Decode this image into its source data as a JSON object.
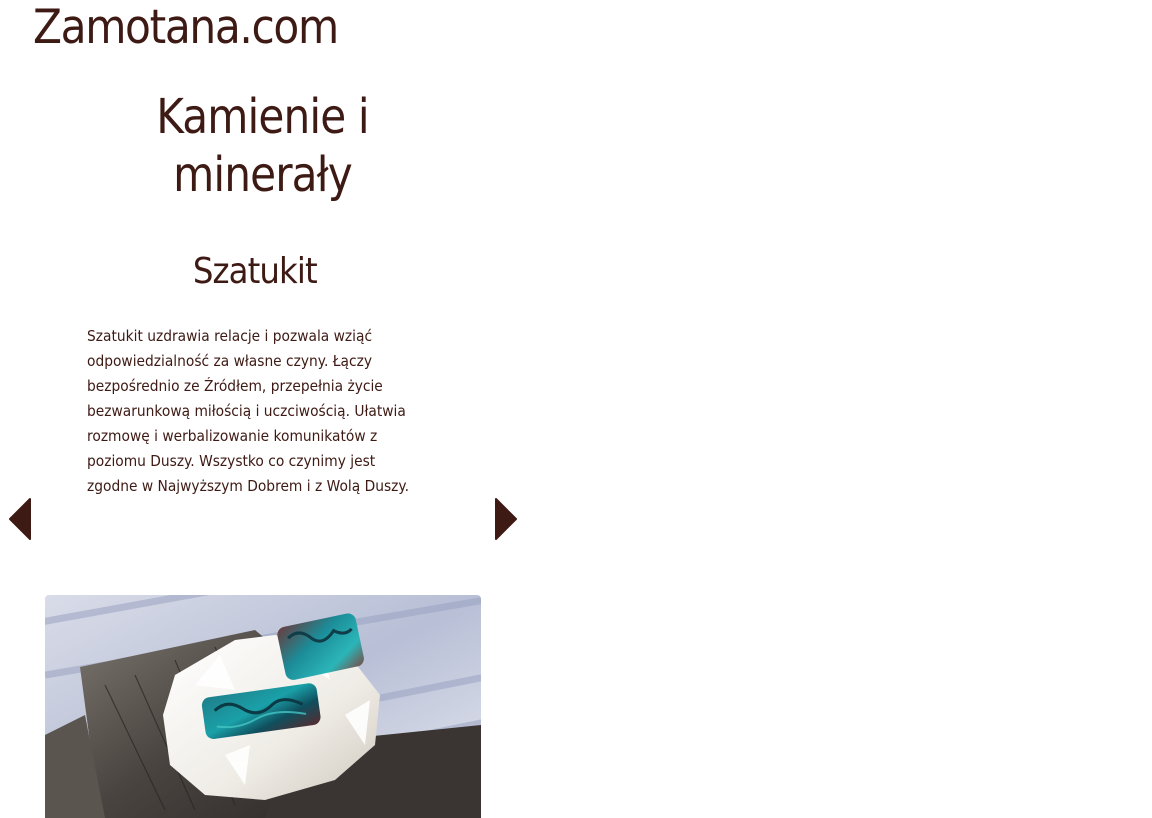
{
  "site": {
    "logo": "Zamotana.com"
  },
  "page": {
    "title_line1": "Kamienie i",
    "title_line2": "minerały"
  },
  "stone": {
    "name": "Szatukit",
    "description": "Szatukit uzdrawia relacje i pozwala wziąć odpowiedzialność za własne czyny. Łączy bezpośrednio ze Źródłem, przepełnia życie bezwarunkową miłością i uczciwością. Ułatwia rozmowę i werbalizowanie komunikatów z poziomu Duszy. Wszystko co czynimy jest zgodne w Najwyższym Dobrem i z Wolą Duszy."
  },
  "carousel": {
    "prev_icon": "caret-left-icon",
    "next_icon": "caret-right-icon"
  },
  "colors": {
    "text": "#3e1a14",
    "arrow": "#3e1a14",
    "background": "#ffffff"
  }
}
